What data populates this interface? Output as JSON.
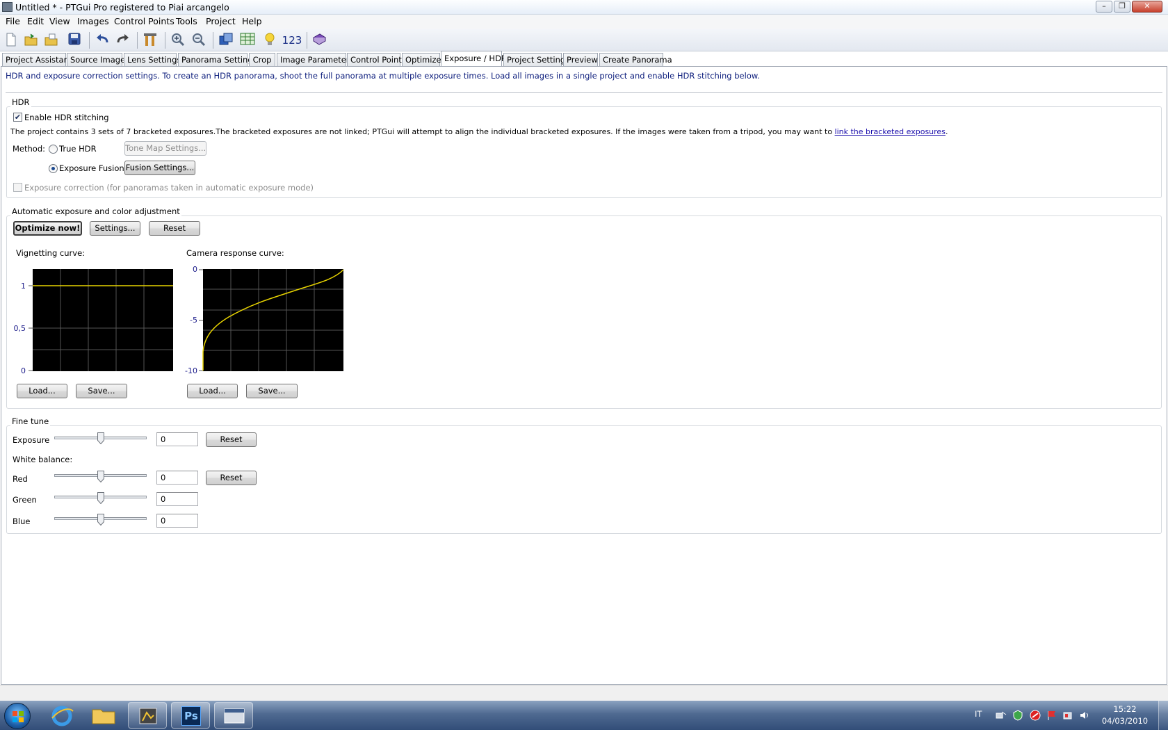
{
  "window": {
    "title": "Untitled * - PTGui Pro registered to Piai arcangelo",
    "controls": [
      "–",
      "❐",
      "✕"
    ]
  },
  "menu": [
    "File",
    "Edit",
    "View",
    "Images",
    "Control Points",
    "Tools",
    "Project",
    "Help"
  ],
  "toolbar": {
    "number_label": "123",
    "icons": [
      "new-file-icon",
      "open-folder-icon",
      "open-recent-icon",
      "save-icon",
      "undo-icon",
      "redo-icon",
      "tools-icon",
      "zoom-in-icon",
      "zoom-out-icon",
      "panorama-editor-icon",
      "table-icon",
      "bulb-icon",
      "numbering-icon",
      "help-book-icon"
    ]
  },
  "tabs": [
    "Project Assistant",
    "Source Images",
    "Lens Settings",
    "Panorama Settings",
    "Crop",
    "Image Parameters",
    "Control Points",
    "Optimizer",
    "Exposure / HDR",
    "Project Settings",
    "Preview",
    "Create Panorama"
  ],
  "active_tab": "Exposure / HDR",
  "info_text": "HDR and exposure correction settings. To create an HDR panorama, shoot the full panorama at multiple exposure times. Load all images in a single project and enable HDR stitching below.",
  "hdr": {
    "title": "HDR",
    "enable_label": "Enable HDR stitching",
    "enable_checked": true,
    "description": "The project contains 3 sets of 7 bracketed exposures.The bracketed exposures are not linked; PTGui will attempt to align the individual bracketed exposures. If the images were taken from a tripod, you may want to ",
    "link_text": "link the bracketed exposures",
    "link_suffix": ".",
    "method_label": "Method:",
    "true_hdr_label": "True HDR",
    "tone_map_button": "Tone Map Settings...",
    "exposure_fusion_label": "Exposure Fusion",
    "fusion_button": "Fusion Settings...",
    "selected_method": "Exposure Fusion",
    "exposure_correction_label": "Exposure correction (for panoramas taken in automatic exposure mode)",
    "exposure_correction_checked": false
  },
  "auto": {
    "title": "Automatic exposure and color adjustment",
    "optimize_button": "Optimize now!",
    "settings_button": "Settings...",
    "reset_button": "Reset",
    "vignetting": {
      "label": "Vignetting curve:",
      "ticks": [
        "1",
        "0,5",
        "0"
      ],
      "load_button": "Load...",
      "save_button": "Save..."
    },
    "response": {
      "label": "Camera response curve:",
      "ticks": [
        "0",
        "-5",
        "-10"
      ],
      "load_button": "Load...",
      "save_button": "Save..."
    }
  },
  "fine_tune": {
    "title": "Fine tune",
    "exposure_label": "Exposure",
    "exposure_value": "0",
    "reset_button": "Reset",
    "white_balance_label": "White balance:",
    "red_label": "Red",
    "red_value": "0",
    "green_label": "Green",
    "green_value": "0",
    "blue_label": "Blue",
    "blue_value": "0",
    "reset_button_2": "Reset"
  },
  "taskbar": {
    "language": "IT",
    "time": "15:22",
    "date": "04/03/2010",
    "photoshop_label": "Ps"
  },
  "colors": {
    "curve": "#e8d400",
    "plot_bg": "#000000",
    "info_text": "#0c1d7c",
    "link": "#1a0dab"
  }
}
